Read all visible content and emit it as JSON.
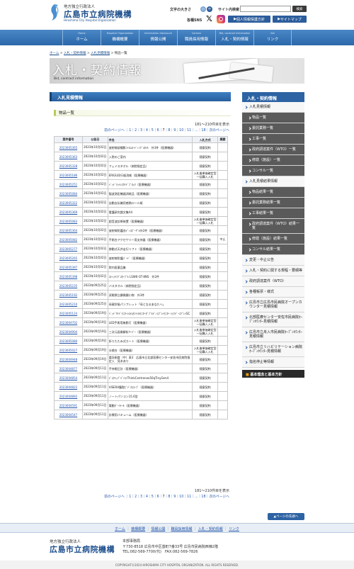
{
  "header": {
    "logo_sub": "地方独立行政法人",
    "logo_main": "広島市立病院機構",
    "logo_en": "Hiroshima City Hospital Organization",
    "font_size_label": "文字の大きさ",
    "font_sizes": [
      "小",
      "中",
      "大"
    ],
    "search_label": "サイト内検索",
    "search_button": "検索",
    "sns_label": "各種SNS",
    "privacy_button": "個人情報保護方針",
    "sitemap_button": "サイトマップ"
  },
  "gnav": [
    {
      "en": "Home",
      "ja": "ホーム"
    },
    {
      "en": "Hospital Organization",
      "ja": "機構概要"
    },
    {
      "en": "Information disclosure",
      "ja": "情報公開"
    },
    {
      "en": "Careers",
      "ja": "職員採用情報"
    },
    {
      "en": "Bid, contract information",
      "ja": "入札・契約情報"
    },
    {
      "en": "link",
      "ja": "リンク"
    }
  ],
  "breadcrumb": [
    "ホーム",
    "入札・契約情報",
    "入札見積情報",
    "物品一覧"
  ],
  "banner": {
    "title": "入札・契約情報",
    "en": "Bid, contract information"
  },
  "section_title": "入札見積情報",
  "sub_title": "物品一覧",
  "count": "181〜210件目を表示",
  "count_bottom": "181〜210件目を表示",
  "pager": {
    "prev": "前のページへ",
    "pages": [
      "1",
      "2",
      "3",
      "4",
      "5",
      "6",
      "7",
      "8",
      "9",
      "10",
      "11",
      "...",
      "18"
    ],
    "current": "7",
    "next": "次のページへ"
  },
  "table": {
    "headers": [
      "案件番号",
      "公告日",
      "件名",
      "入札方式",
      "摘要"
    ],
    "rows": [
      {
        "id": "2023005365",
        "date": "2023年10月02日",
        "title": "放射線部撮影ﾌｨﾙﾑﾛｰﾃﾞｨﾝｸﾞｽﾀｲﾙ　外3件（医療機器）",
        "method": "随意契約",
        "note": ""
      },
      {
        "id": "2023005363",
        "date": "2023年10月02日",
        "title": "入院のご案内",
        "method": "随意契約",
        "note": ""
      },
      {
        "id": "2023005328",
        "date": "2023年10月02日",
        "title": "フェイスタオル（病院指定品）",
        "method": "随意契約",
        "note": ""
      },
      {
        "id": "2023005186",
        "date": "2023年10月02日",
        "title": "ERIGU同行販消耗（医療機器）",
        "method": "入札後単価確定型一括購入入札",
        "note": ""
      },
      {
        "id": "2023005251",
        "date": "2023年10月02日",
        "title": "ﾍﾞｯﾄﾞﾏｯﾄﾚｽｻｲﾄﾞﾌﾞﾛｯｸ（医療機器）",
        "method": "随意契約",
        "note": ""
      },
      {
        "id": "2023005084",
        "date": "2023年10月02日",
        "title": "脳波測定機器消耗品（医療機器）",
        "method": "随意契約",
        "note": ""
      },
      {
        "id": "2023005322",
        "date": "2023年10月02日",
        "title": "自動支払機用感熱ロール紙",
        "method": "随意契約",
        "note": ""
      },
      {
        "id": "2023005369",
        "date": "2023年10月02日",
        "title": "看護研究論文集A4",
        "method": "随意契約",
        "note": ""
      },
      {
        "id": "2023005083",
        "date": "2023年10月02日",
        "title": "超音波診断装置（医療機器）",
        "method": "入札後単価確定型一括購入入札",
        "note": ""
      },
      {
        "id": "2023005364",
        "date": "2023年10月02日",
        "title": "放射線防護衣ﾃﾞｨｽﾎﾟｰｻﾞﾙ外2件（医療機器）",
        "method": "随意契約",
        "note": ""
      },
      {
        "id": "2023005082",
        "date": "2023年10月02日",
        "title": "手術台アクセサリー用支持器（医療機器）",
        "method": "随意契約",
        "note": "中止"
      },
      {
        "id": "2023005277",
        "date": "2023年10月02日",
        "title": "移動式天井走行リフト（医療機器）",
        "method": "随意契約",
        "note": ""
      },
      {
        "id": "2023005265",
        "date": "2023年10月02日",
        "title": "放射線防護ﾊﾞｰﾄﾞ（医療機器）",
        "method": "随意契約",
        "note": ""
      },
      {
        "id": "2023005397",
        "date": "2023年10月02日",
        "title": "院内医薬品集",
        "method": "随意契約",
        "note": ""
      },
      {
        "id": "2023005398",
        "date": "2023年10月02日",
        "title": "ｽﾃｨｯﾁﾝｸﾞｽﾀｰﾌﾟﾙ LSW6-GT-8NS　外2件",
        "method": "随意契約",
        "note": ""
      },
      {
        "id": "2023005235",
        "date": "2023年09月25日",
        "title": "バスタオル（病院指定品）",
        "method": "随意契約",
        "note": ""
      },
      {
        "id": "2023005192",
        "date": "2023年09月25日",
        "title": "双眼倒立顕微鏡小物　外3件",
        "method": "随意契約",
        "note": ""
      },
      {
        "id": "2023005210",
        "date": "2023年09月25日",
        "title": "母親学級パンフレット「母となるあなたへ」",
        "method": "随意契約",
        "note": ""
      },
      {
        "id": "2023005124",
        "date": "2023年09月19日",
        "title": "ﾍﾞｯﾄﾞｻｲﾄﾞﾓﾆﾀｰｼｽﾃﾑｾﾝﾄﾗﾙﾓﾆﾀｰﾀﾞﾌﾞﾙﾃﾞｨｽﾌﾟﾚｲﾓﾆﾀｰ ｼﾗﾌﾃﾞｰｽﾌﾟﾚｲSC",
        "method": "随意契約",
        "note": ""
      },
      {
        "id": "2023004702",
        "date": "2023年09月19日",
        "title": "LED手術用無影灯（医療機器）",
        "method": "入札後単価確定型一括購入入札",
        "note": ""
      },
      {
        "id": "2023004904",
        "date": "2023年09月19日",
        "title": "三次元画像解析ｻｰﾊﾞｰ（医療機器）",
        "method": "入札後単価確定型一括購入入札",
        "note": ""
      },
      {
        "id": "2023005080",
        "date": "2023年09月19日",
        "title": "折りたたみ式カート（医療機器）",
        "method": "随意契約",
        "note": ""
      },
      {
        "id": "2023005027",
        "date": "2023年09月19日",
        "title": "分娩台（医療機器）",
        "method": "入札後単価確定型一括購入入札",
        "note": ""
      },
      {
        "id": "2023004948",
        "date": "2023年09月19日",
        "title": "委託制度（中）表3　広島市立北部医療センター安佐市民病院指定入　見本あり",
        "method": "随意契約",
        "note": ""
      },
      {
        "id": "2023004877",
        "date": "2023年09月11日",
        "title": "手持眼圧計（医療機器）",
        "method": "随意契約",
        "note": ""
      },
      {
        "id": "2023004854",
        "date": "2023年09月11日",
        "title": "ﾃﾞｽｸﾄｯﾌﾟﾊﾟｿｺﾝThinkCentreneo50qTinyGen4",
        "method": "随意契約",
        "note": ""
      },
      {
        "id": "2023004822",
        "date": "2023年09月11日",
        "title": "VISERA腹腔ﾋﾞﾃﾞｵｽｺｰﾌﾟ（医療機器）",
        "method": "随意契約",
        "note": ""
      },
      {
        "id": "2023004892",
        "date": "2023年09月11日",
        "title": "ノートパソコン15.6型",
        "method": "随意契約",
        "note": ""
      },
      {
        "id": "2023004591",
        "date": "2023年09月11日",
        "title": "電動ﾀﾞｰﾂﾃｰﾙ（医療機器）",
        "method": "随意契約",
        "note": ""
      },
      {
        "id": "2023004547",
        "date": "2023年09月11日",
        "title": "診療用バキューム（医療機器）",
        "method": "随意契約",
        "note": ""
      }
    ]
  },
  "sidebar": {
    "title": "入札・契約情報",
    "items": [
      {
        "label": "入札見積情報",
        "type": "main"
      },
      {
        "label": "物品一覧",
        "type": "dark"
      },
      {
        "label": "委託業務一覧",
        "type": "dark"
      },
      {
        "label": "工事一覧",
        "type": "dark"
      },
      {
        "label": "政府調達案件（WTO）一覧",
        "type": "dark"
      },
      {
        "label": "修繕（施設）一覧",
        "type": "dark"
      },
      {
        "label": "コンサル一覧",
        "type": "dark"
      },
      {
        "label": "入札見積結果情報",
        "type": "main"
      },
      {
        "label": "物品結果一覧",
        "type": "dark"
      },
      {
        "label": "委託業務結果一覧",
        "type": "dark"
      },
      {
        "label": "工事結果一覧",
        "type": "dark"
      },
      {
        "label": "政府調達案件（WTO）結果一覧",
        "type": "dark"
      },
      {
        "label": "修繕（施設）結果一覧",
        "type": "dark"
      },
      {
        "label": "コンサル結果一覧",
        "type": "dark"
      },
      {
        "label": "変更・中止公告",
        "type": "main"
      },
      {
        "label": "入札・契約に関する規程・要綱等",
        "type": "main"
      },
      {
        "label": "政府調達案件（WTO）",
        "type": "main"
      },
      {
        "label": "各種帳票・様式",
        "type": "main"
      },
      {
        "label": "広島市立広島市民病院オープンカウンター見積情報",
        "type": "main"
      },
      {
        "label": "北部医療センター安佐市民病院ｵｰﾌﾟﾝｶｳﾝﾀｰ見積情報",
        "type": "main"
      },
      {
        "label": "広島市立舟入市民病院ｵｰﾌﾟﾝｶｳﾝﾀｰ見積情報",
        "type": "main"
      },
      {
        "label": "広島市立リハビリテーション病院ｵｰﾌﾟﾝｶｳﾝﾀｰ見積情報",
        "type": "main"
      },
      {
        "label": "指名停止等情報",
        "type": "main"
      }
    ],
    "button": "基本理念と基本方針"
  },
  "page_top": "ページの先頭へ",
  "footer": {
    "nav": [
      "ホーム",
      "機構概要",
      "情報公開",
      "職員採用情報",
      "入札・契約情報",
      "リンク"
    ],
    "logo_sub": "地方独立行政法人",
    "logo_main": "広島市立病院機構",
    "office": "本部事務局",
    "address": "〒730-8518 広島市中区基町7番33号 広島市民病院西棟2階",
    "tel": "TEL:082-569-7700(代)　FAX:082-569-7826",
    "copyright": "COPYRIGHT©2024 HIROSHIMA CITY HOSPITAL ORGANIZATION. ALL RIGHTS RESERVED."
  },
  "colors": {
    "primary": "#2d63a3",
    "nav_top": "#4a87c6",
    "accent": "#b9c95a",
    "link": "#2255aa"
  }
}
